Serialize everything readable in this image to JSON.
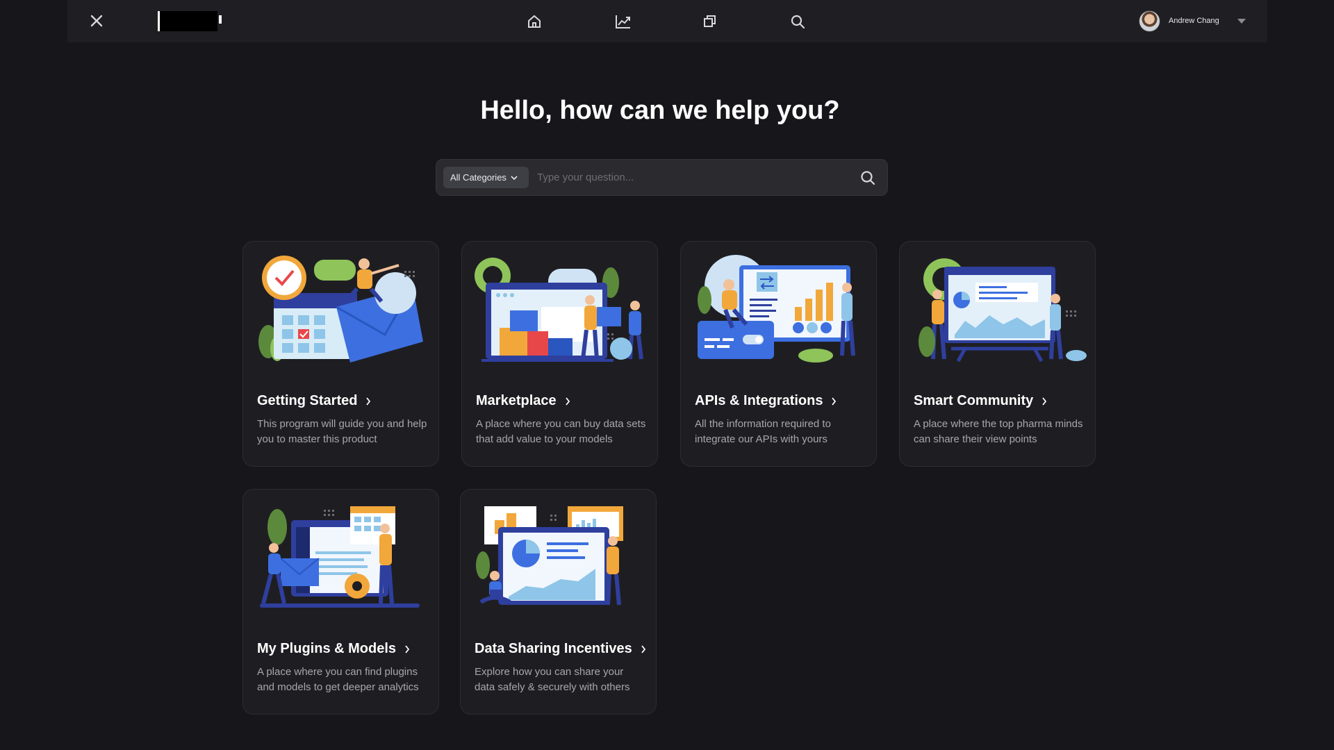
{
  "topbar": {
    "user_name": "Andrew Chang",
    "icons": [
      "close-icon",
      "home-icon",
      "chart-icon",
      "copy-icon",
      "search-icon",
      "chevron-down-icon"
    ]
  },
  "hero": {
    "title": "Hello, how can we help you?"
  },
  "search": {
    "category": "All Categories",
    "placeholder": "Type your question..."
  },
  "cards": [
    {
      "title": "Getting Started",
      "desc": "This program will guide you and help you to master this product"
    },
    {
      "title": "Marketplace",
      "desc": "A place where you can buy data sets that add value to your models"
    },
    {
      "title": "APIs & Integrations",
      "desc": "All the information required to integrate our APIs with yours"
    },
    {
      "title": "Smart Community",
      "desc": "A place where the top pharma minds can share their view points"
    },
    {
      "title": "My Plugins & Models",
      "desc": "A place where you can find plugins and models to get deeper analytics"
    },
    {
      "title": "Data Sharing Incentives",
      "desc": "Explore how you can share your data safely & securely with others"
    }
  ],
  "colors": {
    "background": "#17171b",
    "topbar": "#1f1f23",
    "card": "#1e1e22",
    "accent_blue": "#3d6fe0",
    "accent_orange": "#f2a73a"
  }
}
